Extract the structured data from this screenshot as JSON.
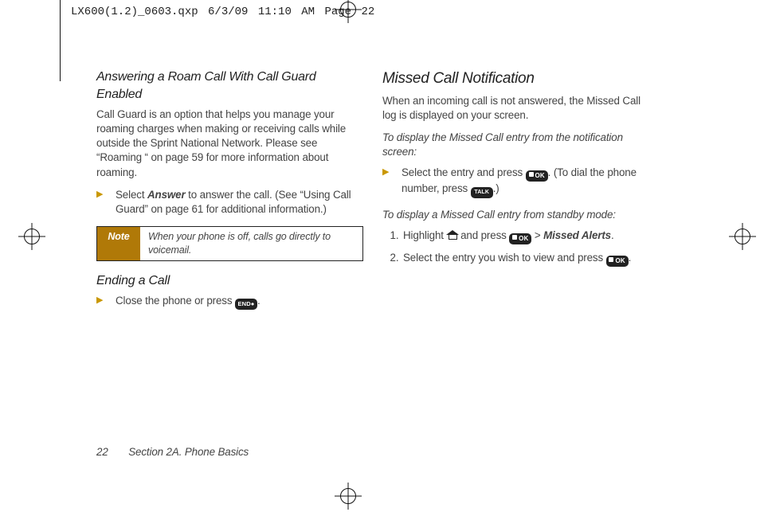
{
  "slug": "LX600(1.2)_0603.qxp  6/3/09  11:10 AM  Page 22",
  "left": {
    "h1": "Answering a Roam Call With Call Guard Enabled",
    "p1": "Call Guard is an option that helps you manage your roaming charges when making or receiving calls while outside the Sprint National Network. Please see “Roaming “ on page 59 for more information about roaming.",
    "bul1a": "Select ",
    "bul1_kw": "Answer",
    "bul1b": " to answer the call. (See “Using Call Guard” on page 61 for additional information.)",
    "note_label": "Note",
    "note_text": "When your phone is off, calls go directly to voicemail.",
    "h2": "Ending a Call",
    "bul2a": "Close the phone or press ",
    "bul2b": "."
  },
  "right": {
    "h1": "Missed Call Notification",
    "p1": "When an incoming call is not answered, the Missed Call log is displayed on your screen.",
    "instr1": "To display the Missed Call entry from the notification screen:",
    "bul1a": "Select the entry and press ",
    "bul1b": ". (To dial the phone number, press ",
    "bul1c": ".)",
    "instr2": "To display a Missed Call entry from standby mode:",
    "step1a": "Highlight ",
    "step1b": " and press ",
    "step1c": " > ",
    "step1_kw": "Missed Alerts",
    "step1d": ".",
    "step2a": "Select the entry you wish to view and press ",
    "step2b": "."
  },
  "key": {
    "ok": "OK",
    "talk": "TALK",
    "end": "END●"
  },
  "footer_page": "22",
  "footer_section": "Section 2A. Phone Basics"
}
